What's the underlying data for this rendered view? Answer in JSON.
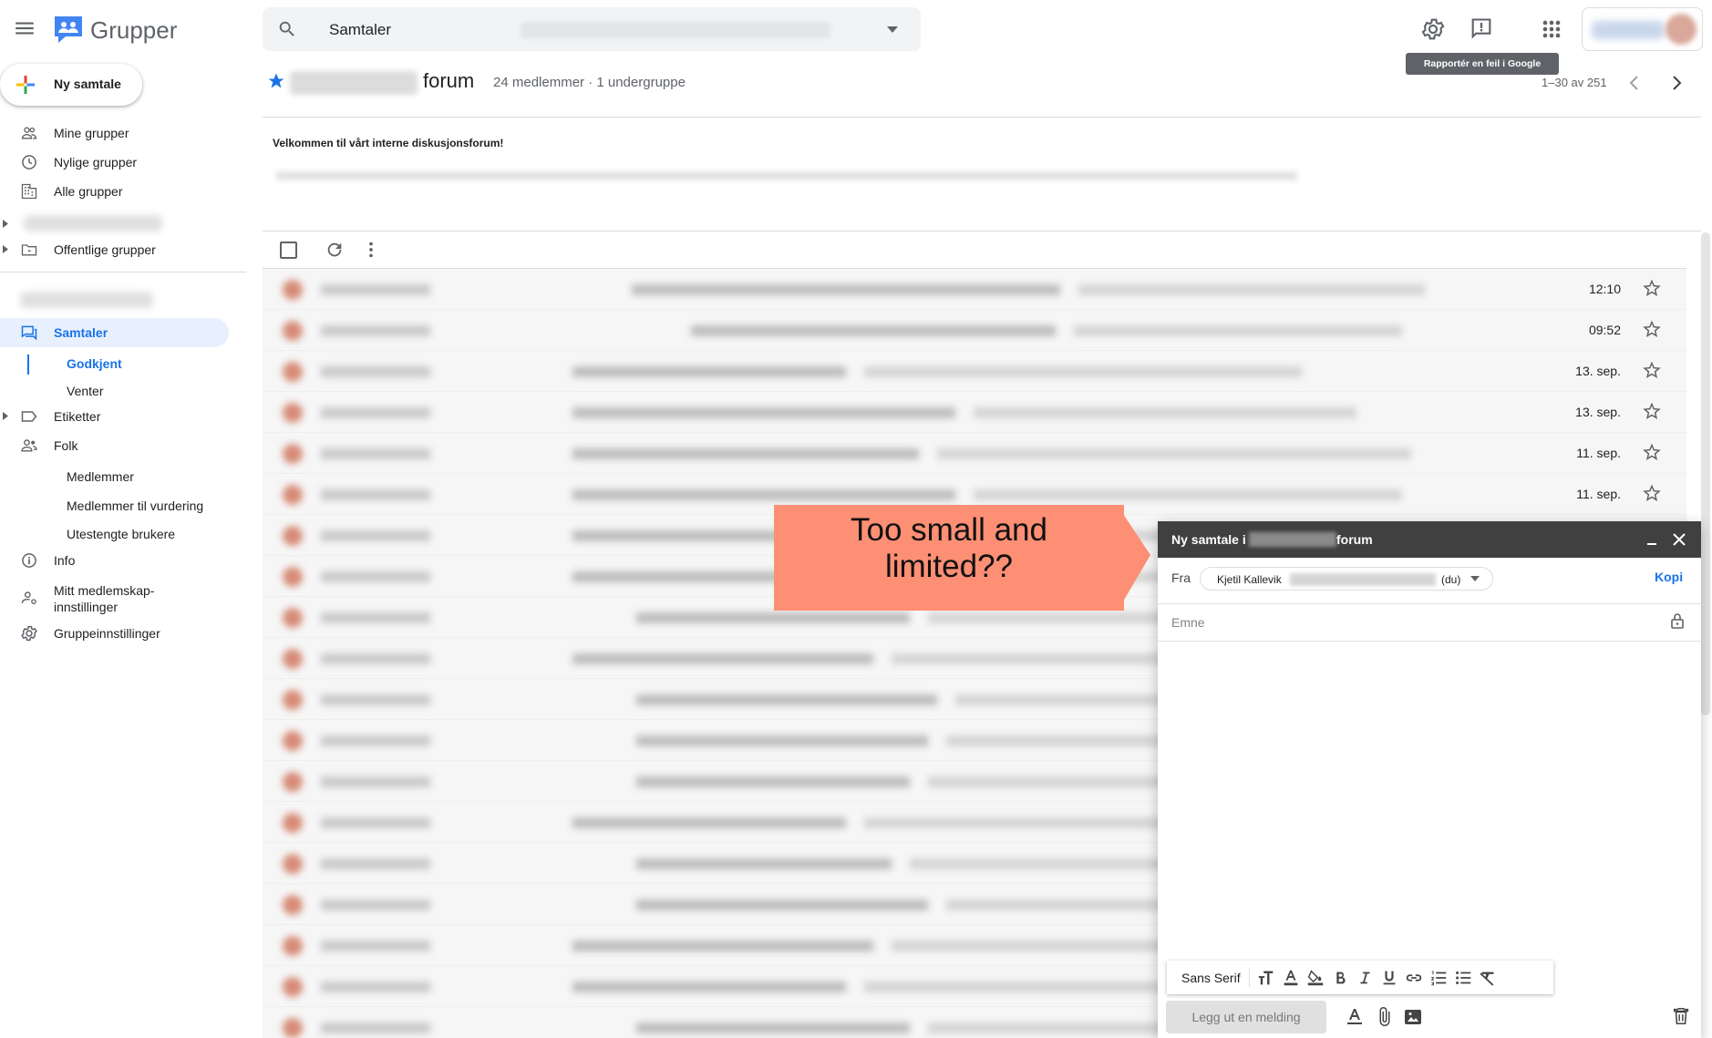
{
  "app": {
    "title": "Grupper"
  },
  "search": {
    "scope": "Samtaler"
  },
  "topbar": {
    "tooltip": "Rapportér en feil i Google Grupper"
  },
  "sidebar": {
    "new_button": "Ny samtale",
    "items": [
      {
        "label": "Mine grupper"
      },
      {
        "label": "Nylige grupper"
      },
      {
        "label": "Alle grupper"
      },
      {
        "label": "Offentlige grupper"
      },
      {
        "label": "Samtaler"
      },
      {
        "label": "Godkjent"
      },
      {
        "label": "Venter"
      },
      {
        "label": "Etiketter"
      },
      {
        "label": "Folk"
      },
      {
        "label": "Medlemmer"
      },
      {
        "label": "Medlemmer til vurdering"
      },
      {
        "label": "Utestengte brukere"
      },
      {
        "label": "Info"
      },
      {
        "label": "Mitt medlemskap-"
      },
      {
        "label": "innstillinger"
      },
      {
        "label": "Gruppeinnstillinger"
      }
    ]
  },
  "group": {
    "name": "forum",
    "meta": "24 medlemmer · 1 undergruppe",
    "welcome": "Velkommen til vårt interne diskusjonsforum!",
    "pager": "1–30 av 251"
  },
  "threads": [
    {
      "date": "12:10"
    },
    {
      "date": "09:52"
    },
    {
      "date": "13. sep."
    },
    {
      "date": "13. sep."
    },
    {
      "date": "11. sep."
    },
    {
      "date": "11. sep."
    },
    {
      "date": ""
    },
    {
      "date": ""
    },
    {
      "date": ""
    },
    {
      "date": ""
    },
    {
      "date": ""
    },
    {
      "date": ""
    },
    {
      "date": ""
    },
    {
      "date": ""
    },
    {
      "date": ""
    },
    {
      "date": ""
    },
    {
      "date": ""
    },
    {
      "date": ""
    },
    {
      "date": ""
    }
  ],
  "annotation": {
    "line1": "Too small and",
    "line2": "limited??"
  },
  "compose": {
    "title_prefix": "Ny samtale i",
    "title_suffix": "forum",
    "from_label": "Fra",
    "from_name": "Kjetil Kallevik",
    "from_you": "(du)",
    "cc_label": "Kopi",
    "subject_placeholder": "Emne",
    "font": "Sans Serif",
    "post_button": "Legg ut en melding"
  },
  "icons": {
    "menu": "hamburger-menu-icon",
    "search": "search-icon",
    "settings": "gear-icon",
    "feedback": "feedback-icon",
    "apps": "apps-grid-icon",
    "star": "star-icon",
    "trash": "trash-icon"
  },
  "colors": {
    "accent": "#1a73e8",
    "compose_header": "#404040",
    "annotation": "#fd8f74"
  }
}
